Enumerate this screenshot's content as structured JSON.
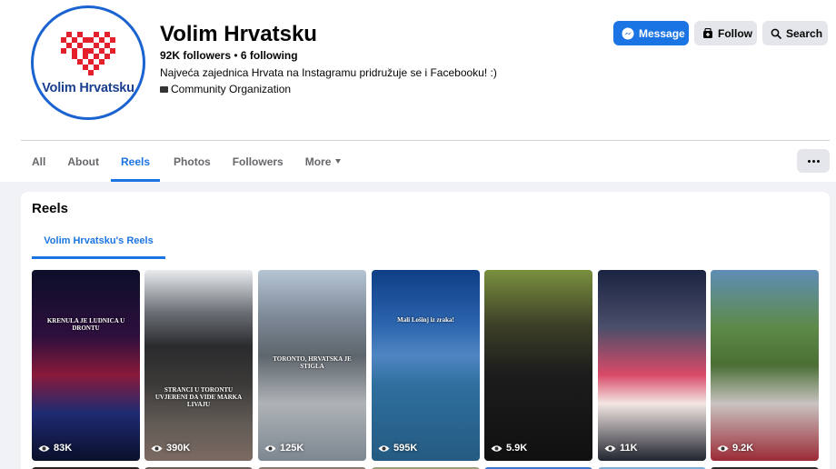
{
  "page": {
    "name": "Volim Hrvatsku",
    "followers": "92K followers",
    "separator": "•",
    "following": "6 following",
    "bio": "Najveća zajednica Hrvata na Instagramu pridružuje se i Facebooku! :)",
    "category": "Community Organization",
    "logo_text": "Volim Hrvatsku"
  },
  "actions": {
    "message": "Message",
    "follow": "Follow",
    "search": "Search"
  },
  "tabs": [
    "All",
    "About",
    "Reels",
    "Photos",
    "Followers",
    "More"
  ],
  "active_tab": "Reels",
  "reels": {
    "title": "Reels",
    "subtab": "Volim Hrvatsku's Reels",
    "items": [
      {
        "views": "83K",
        "caption": "KRENULA JE LUDNICA U DRONTU"
      },
      {
        "views": "390K",
        "caption": "STRANCI U TORONTU UVJERENI DA VIDE MARKA LIVAJU"
      },
      {
        "views": "125K",
        "caption": "TORONTO, HRVATSKA JE STIGLA"
      },
      {
        "views": "595K",
        "caption": "Mali Lošinj iz zraka!"
      },
      {
        "views": "5.9K",
        "caption": ""
      },
      {
        "views": "11K",
        "caption": ""
      },
      {
        "views": "9.2K",
        "caption": ""
      }
    ]
  },
  "colors": {
    "accent": "#1b74e4",
    "logo_red": "#e3202b",
    "logo_blue": "#1b3f8f"
  }
}
